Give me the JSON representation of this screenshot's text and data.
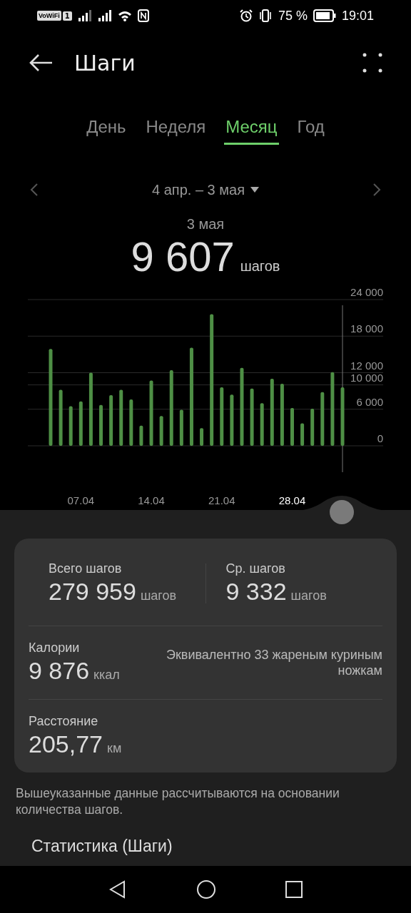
{
  "status_bar": {
    "wifi_calling": "VoWiFi",
    "sim": "1",
    "battery": "75 %",
    "time": "19:01"
  },
  "header": {
    "title": "Шаги"
  },
  "tabs": [
    {
      "label": "День",
      "selected": false
    },
    {
      "label": "Неделя",
      "selected": false
    },
    {
      "label": "Месяц",
      "selected": true
    },
    {
      "label": "Год",
      "selected": false
    }
  ],
  "period": {
    "range": "4 апр. – 3 мая",
    "date": "3 мая",
    "value": "9 607",
    "unit": "шагов"
  },
  "chart": {
    "chart_data": {
      "type": "bar",
      "categories": [
        null,
        null,
        null,
        "07.04",
        null,
        null,
        null,
        null,
        null,
        null,
        "14.04",
        null,
        null,
        null,
        null,
        null,
        null,
        "21.04",
        null,
        null,
        null,
        null,
        null,
        null,
        "28.04",
        null,
        null,
        null,
        null,
        null
      ],
      "series": [
        {
          "color": "#4e8f45",
          "values": [
            15900,
            9200,
            6500,
            7300,
            12000,
            6700,
            8300,
            9200,
            7600,
            3300,
            10700,
            4900,
            12400,
            5900,
            16100,
            2900,
            21600,
            9600,
            8400,
            12800,
            9400,
            7000,
            11000,
            10200,
            6200,
            3700,
            6100,
            8800,
            12100,
            9600
          ]
        }
      ],
      "ylim": [
        0,
        24000
      ],
      "grid": true,
      "yticks": [
        {
          "value": 0,
          "label": "0"
        },
        {
          "value": 6000,
          "label": "6 000"
        },
        {
          "value": 10000,
          "label": "10 000"
        },
        {
          "value": 12000,
          "label": "12 000"
        },
        {
          "value": 18000,
          "label": "18 000"
        },
        {
          "value": 24000,
          "label": "24 000"
        }
      ]
    }
  },
  "summary": {
    "total_label": "Всего шагов",
    "total_value": "279 959",
    "total_unit": "шагов",
    "avg_label": "Ср. шагов",
    "avg_value": "9 332",
    "avg_unit": "шагов",
    "calories_label": "Калории",
    "calories_value": "9 876",
    "calories_unit": "ккал",
    "calories_note": "Эквивалентно 33 жареным куриным ножкам",
    "distance_label": "Расстояние",
    "distance_value": "205,77",
    "distance_unit": "км"
  },
  "note": "Вышеуказанные данные рассчитываются на основании количества шагов.",
  "section_title": "Статистика (Шаги)"
}
